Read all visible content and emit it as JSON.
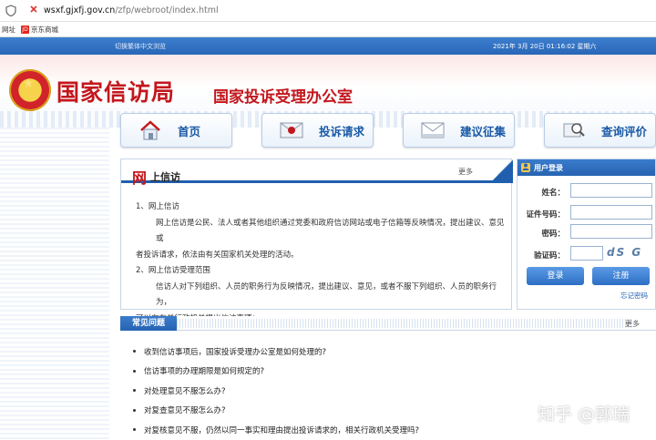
{
  "browser": {
    "url_host": "wsxf.gjxfj.gov.cn",
    "url_path": "/zfp/webroot/index.html",
    "bookmarks": [
      "网址",
      "京东商城"
    ],
    "jd_icon": "JD"
  },
  "topstrip": {
    "switch_label": "切换繁体中文浏览",
    "datetime": "2021年 3月 20日 01:16:02 星期六"
  },
  "header": {
    "title": "国家信访局",
    "subtitle": "国家投诉受理办公室"
  },
  "nav": [
    {
      "label": "首页",
      "icon": "house-icon"
    },
    {
      "label": "投诉请求",
      "icon": "envelope-icon"
    },
    {
      "label": "建议征集",
      "icon": "letter-icon"
    },
    {
      "label": "查询评价",
      "icon": "search-document-icon"
    }
  ],
  "xinfang": {
    "title_mark": "网",
    "title_rest": "上信访",
    "more": "更多",
    "lines": [
      "1、网上信访",
      "网上信访是公民、法人或者其他组织通过党委和政府信访网站或电子信箱等反映情况，提出建议、意见或",
      "者投诉请求，依法由有关国家机关处理的活动。",
      "2、网上信访受理范围",
      "信访人对下列组织、人员的职务行为反映情况，提出建议、意见，或者不服下列组织、人员的职务行为，",
      "可以向有关行政机关提出信访事项："
    ]
  },
  "login": {
    "title": "用户登录",
    "fields": [
      "姓名：",
      "证件号码：",
      "密码：",
      "验证码："
    ],
    "captcha": "dS G",
    "login_button": "登录",
    "register_button": "注册",
    "forgot": "忘记密码"
  },
  "faq": {
    "tab": "常见问题",
    "more": "更多",
    "items": [
      "收到信访事项后，国家投诉受理办公室是如何处理的?",
      "信访事项的办理期限是如何规定的?",
      "对处理意见不服怎么办?",
      "对复查意见不服怎么办?",
      "对复核意见不服，仍然以同一事实和理由提出投诉请求的，相关行政机关受理吗?"
    ]
  },
  "watermark": "知乎 @郭瑞",
  "colors": {
    "brand_red": "#c3171d",
    "brand_blue": "#1f5fae"
  }
}
